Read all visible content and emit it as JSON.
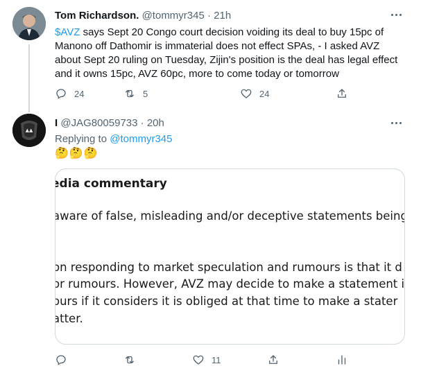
{
  "tweet1": {
    "author_name": "Tom Richardson.",
    "handle": "@tommyr345",
    "separator": "·",
    "time": "21h",
    "cashtag": "$AVZ",
    "text_rest": " says Sept 20 Congo court decision voiding its deal to buy 15pc of Manono off Dathomir is immaterial does not effect SPAs, - I asked AVZ about Sept 20 ruling on Tuesday, Zijin's position is the deal has legal effect and it owns 15pc, AVZ 60pc, more to come today or tomorrow",
    "reply_count": "24",
    "retweet_count": "5",
    "like_count": "24"
  },
  "tweet2": {
    "author_name": "I",
    "handle": "@JAG80059733",
    "separator": "·",
    "time": "20h",
    "replying_prefix": "Replying to ",
    "replying_handle": "@tommyr345",
    "emojis": "🤔🤔🤔",
    "media": {
      "title": "edia commentary",
      "lines": [
        "aware of false, misleading and/or deceptive statements being p",
        "on responding to market speculation and rumours is that it d",
        "or rumours. However, AVZ may decide to make a statement in",
        "ours if it considers it is obliged at that time to make a stater",
        "atter."
      ]
    },
    "like_count": "11"
  },
  "icons": [
    "reply-icon",
    "retweet-icon",
    "like-icon",
    "share-icon",
    "analytics-icon",
    "more-icon"
  ],
  "colors": {
    "accent": "#1d9bf0",
    "secondary_text": "#536471",
    "border": "#cfd9de"
  }
}
